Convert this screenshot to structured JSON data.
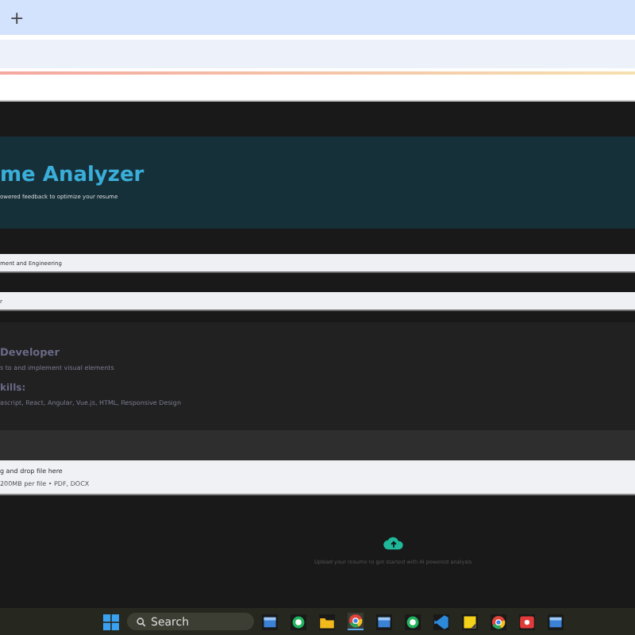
{
  "browser": {
    "new_tab": "+"
  },
  "header": {
    "title": "me Analyzer",
    "subtitle": "owered feedback to optimize your resume"
  },
  "fields": [
    {
      "value": "ment and Engineering"
    },
    {
      "value": "r"
    }
  ],
  "job_card": {
    "title": "Developer",
    "description": "s to and implement visual elements",
    "skills_heading": "kills:",
    "skills": "ascript, React, Angular, Vue.js, HTML, Responsive Design"
  },
  "uploader": {
    "prompt": "g and drop file here",
    "limit": "200MB per file • PDF, DOCX"
  },
  "empty_state": {
    "message": "Upload your resume to get started with AI powered analysis"
  },
  "taskbar": {
    "search": {
      "placeholder": "Search"
    },
    "apps": [
      {
        "kind": "window"
      },
      {
        "kind": "chat"
      },
      {
        "kind": "folder"
      },
      {
        "kind": "browser",
        "selected": true
      },
      {
        "kind": "window"
      },
      {
        "kind": "chat"
      },
      {
        "kind": "code"
      },
      {
        "kind": "note"
      },
      {
        "kind": "browser",
        "selected": false
      },
      {
        "kind": "media"
      },
      {
        "kind": "window"
      }
    ]
  }
}
